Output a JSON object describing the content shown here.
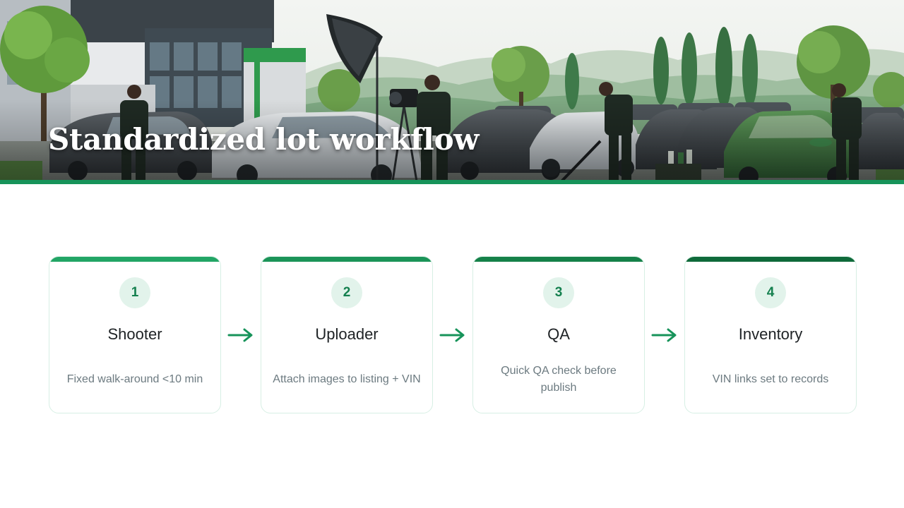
{
  "page": {
    "title": "Standardized lot workflow"
  },
  "colors": {
    "accent": "#17935a",
    "badge_bg": "#e2f3eb",
    "badge_text": "#15804f",
    "card_border": "#d7efe4",
    "step_bars": [
      "#22a565",
      "#1b9458",
      "#158149",
      "#0f6a3a"
    ]
  },
  "steps": [
    {
      "number": "1",
      "title": "Shooter",
      "description": "Fixed walk-around <10 min"
    },
    {
      "number": "2",
      "title": "Uploader",
      "description": "Attach images to listing + VIN"
    },
    {
      "number": "3",
      "title": "QA",
      "description": "Quick QA check before publish"
    },
    {
      "number": "4",
      "title": "Inventory",
      "description": "VIN links set to records"
    }
  ],
  "icons": {
    "connector": "arrow-right-icon"
  }
}
